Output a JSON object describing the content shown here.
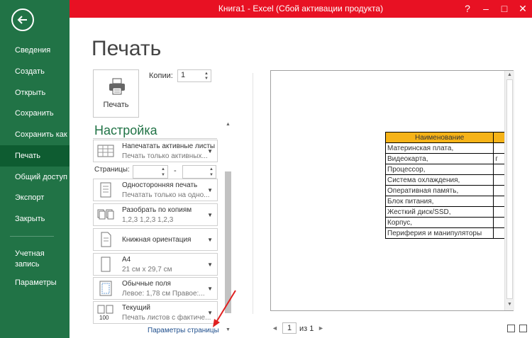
{
  "window": {
    "title": "Книга1 -  Excel (Сбой активации продукта)",
    "help": "?",
    "minimize": "–",
    "maximize": "□",
    "close": "✕"
  },
  "colors": {
    "titlebar": "#e81123",
    "sidebar": "#217346",
    "accent": "#217346",
    "header_fill": "#f6b318"
  },
  "sidebar": {
    "items": [
      {
        "label": "Сведения"
      },
      {
        "label": "Создать"
      },
      {
        "label": "Открыть"
      },
      {
        "label": "Сохранить"
      },
      {
        "label": "Сохранить как"
      },
      {
        "label": "Печать"
      },
      {
        "label": "Общий доступ"
      },
      {
        "label": "Экспорт"
      },
      {
        "label": "Закрыть"
      }
    ],
    "active": "Печать",
    "account": "Учетная запись",
    "options": "Параметры"
  },
  "main": {
    "title": "Печать",
    "print_button": "Печать",
    "copies_label": "Копии:",
    "copies_value": "1",
    "settings_title": "Настройка",
    "pages_label": "Страницы:",
    "pages_dash": "-",
    "options": [
      {
        "line1": "Напечатать активные листы",
        "line2": "Печать только активных..."
      },
      {
        "line1": "Односторонняя печать",
        "line2": "Печатать только на одно..."
      },
      {
        "line1": "Разобрать по копиям",
        "line2": "1,2,3    1,2,3    1,2,3"
      },
      {
        "line1": "Книжная ориентация",
        "line2": ""
      },
      {
        "line1": "A4",
        "line2": "21 см x 29,7 см"
      },
      {
        "line1": "Обычные поля",
        "line2": "Левое: 1,78 см    Правое:..."
      },
      {
        "line1": "Текущий",
        "line2": "Печать листов с фактиче..."
      }
    ],
    "page_setup_link": "Параметры страницы"
  },
  "preview": {
    "table_header": "Наименование",
    "rows": [
      "Материнская плата,",
      "Видеокарта,",
      "Процессор,",
      "Система охлаждения,",
      "Оперативная память,",
      "Блок питания,",
      "Жесткий диск/SSD,",
      "Корпус,",
      "Периферия и манипуляторы"
    ],
    "overflow_char": "г",
    "page_current": "1",
    "page_total": "из 1"
  }
}
